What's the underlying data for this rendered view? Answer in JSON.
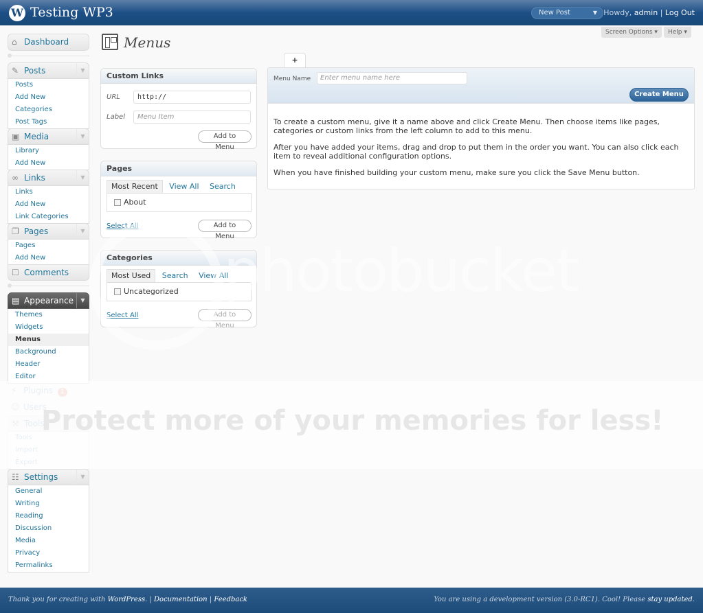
{
  "header": {
    "site_title": "Testing WP3",
    "favorite_action": "New Post",
    "howdy": "Howdy,",
    "username": "admin",
    "separator": " | ",
    "logout": "Log Out"
  },
  "meta_buttons": {
    "screen_options": "Screen Options",
    "help": "Help"
  },
  "sidebar": {
    "dashboard": "Dashboard",
    "posts": {
      "label": "Posts",
      "items": [
        "Posts",
        "Add New",
        "Categories",
        "Post Tags"
      ]
    },
    "media": {
      "label": "Media",
      "items": [
        "Library",
        "Add New"
      ]
    },
    "links": {
      "label": "Links",
      "items": [
        "Links",
        "Add New",
        "Link Categories"
      ]
    },
    "pages": {
      "label": "Pages",
      "items": [
        "Pages",
        "Add New"
      ]
    },
    "comments": "Comments",
    "appearance": {
      "label": "Appearance",
      "items": [
        "Themes",
        "Widgets",
        "Menus",
        "Background",
        "Header",
        "Editor"
      ],
      "current": "Menus"
    },
    "plugins": {
      "label": "Plugins",
      "badge": "1"
    },
    "users": "Users",
    "tools": {
      "label": "Tools",
      "items": [
        "Tools",
        "Import",
        "Export"
      ]
    },
    "settings": {
      "label": "Settings",
      "items": [
        "General",
        "Writing",
        "Reading",
        "Discussion",
        "Media",
        "Privacy",
        "Permalinks"
      ]
    }
  },
  "page": {
    "title": "Menus"
  },
  "custom_links": {
    "title": "Custom Links",
    "url_label": "URL",
    "url_value": "http://",
    "label_label": "Label",
    "label_placeholder": "Menu Item",
    "add_button": "Add to Menu"
  },
  "pages_box": {
    "title": "Pages",
    "tabs": [
      "Most Recent",
      "View All",
      "Search"
    ],
    "active_tab": "Most Recent",
    "items": [
      "About"
    ],
    "select_all": "Select All",
    "add_button": "Add to Menu"
  },
  "categories_box": {
    "title": "Categories",
    "tabs": [
      "Most Used",
      "Search",
      "View All"
    ],
    "active_tab": "Most Used",
    "items": [
      "Uncategorized"
    ],
    "select_all": "Select All",
    "add_button": "Add to Menu"
  },
  "menu_editor": {
    "new_tab": "+",
    "name_label": "Menu Name",
    "name_placeholder": "Enter menu name here",
    "create_button": "Create Menu",
    "instructions": [
      "To create a custom menu, give it a name above and click Create Menu. Then choose items like pages, categories or custom links from the left column to add to this menu.",
      "After you have added your items, drag and drop to put them in the order you want. You can also click each item to reveal additional configuration options.",
      "When you have finished building your custom menu, make sure you click the Save Menu button."
    ]
  },
  "footer": {
    "thanks": "Thank you for creating with ",
    "wordpress": "WordPress",
    "dot_sep": ". | ",
    "documentation": "Documentation",
    "sep": " | ",
    "feedback": "Feedback",
    "version_text": "You are using a development version (3.0-RC1). Cool! Please ",
    "stay_updated": "stay updated",
    "period": "."
  },
  "watermark": {
    "brand": "photobucket",
    "slogan": "Protect more of your memories for less!"
  },
  "colors": {
    "header": "#1c4f86",
    "current_menu": "#464646",
    "link": "#21759b",
    "primary_button": "#2b6399",
    "badge": "#d54e21"
  }
}
